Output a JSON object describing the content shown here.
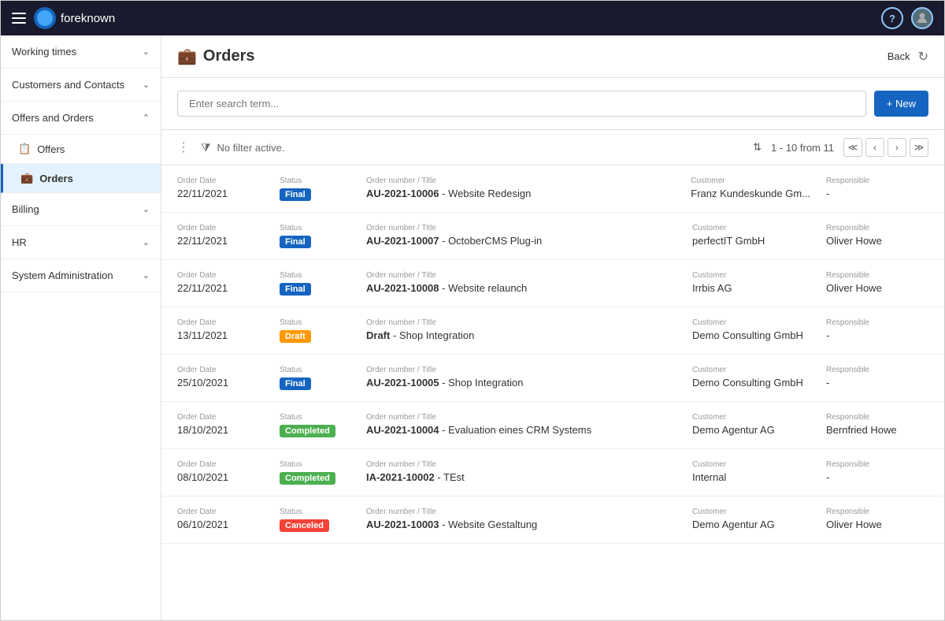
{
  "topbar": {
    "logo_text": "foreknown",
    "help_icon": "?",
    "avatar_icon": "👤"
  },
  "sidebar": {
    "items": [
      {
        "id": "working-times",
        "label": "Working times",
        "expanded": false,
        "has_chevron": true
      },
      {
        "id": "customers-contacts",
        "label": "Customers and Contacts",
        "expanded": false,
        "has_chevron": true
      },
      {
        "id": "offers-orders",
        "label": "Offers and Orders",
        "expanded": true,
        "has_chevron": true,
        "children": [
          {
            "id": "offers",
            "label": "Offers",
            "icon": "📋",
            "current": false
          },
          {
            "id": "orders",
            "label": "Orders",
            "icon": "💼",
            "current": true
          }
        ]
      },
      {
        "id": "billing",
        "label": "Billing",
        "expanded": false,
        "has_chevron": true
      },
      {
        "id": "hr",
        "label": "HR",
        "expanded": false,
        "has_chevron": true
      },
      {
        "id": "system-administration",
        "label": "System Administration",
        "expanded": false,
        "has_chevron": true
      }
    ]
  },
  "page": {
    "title": "Orders",
    "back_label": "Back",
    "new_button_label": "+ New",
    "search_placeholder": "Enter search term...",
    "filter_text": "No filter active.",
    "pagination": {
      "range": "1 - 10 from 11"
    }
  },
  "orders": [
    {
      "date_label": "Order Date",
      "date": "22/11/2021",
      "status_label": "Status",
      "status": "Final",
      "status_type": "final",
      "order_label": "Order number / Title",
      "order_number": "AU-2021-10006",
      "title": "Website Redesign",
      "customer_label": "Customer",
      "customer": "Franz Kundeskunde Gm...",
      "responsible_label": "Responsible",
      "responsible": "-"
    },
    {
      "date_label": "Order Date",
      "date": "22/11/2021",
      "status_label": "Status",
      "status": "Final",
      "status_type": "final",
      "order_label": "Order number / Title",
      "order_number": "AU-2021-10007",
      "title": "OctoberCMS Plug-in",
      "customer_label": "Customer",
      "customer": "perfectIT GmbH",
      "responsible_label": "Responsible",
      "responsible": "Oliver Howe"
    },
    {
      "date_label": "Order Date",
      "date": "22/11/2021",
      "status_label": "Status",
      "status": "Final",
      "status_type": "final",
      "order_label": "Order number / Title",
      "order_number": "AU-2021-10008",
      "title": "Website relaunch",
      "customer_label": "Customer",
      "customer": "Irrbis AG",
      "responsible_label": "Responsible",
      "responsible": "Oliver Howe"
    },
    {
      "date_label": "Order Date",
      "date": "13/11/2021",
      "status_label": "Status",
      "status": "Draft",
      "status_type": "draft",
      "order_label": "Order number / Title",
      "order_number": "Draft",
      "title": "Shop Integration",
      "is_draft_title": true,
      "customer_label": "Customer",
      "customer": "Demo Consulting GmbH",
      "responsible_label": "Responsible",
      "responsible": "-"
    },
    {
      "date_label": "Order Date",
      "date": "25/10/2021",
      "status_label": "Status",
      "status": "Final",
      "status_type": "final",
      "order_label": "Order number / Title",
      "order_number": "AU-2021-10005",
      "title": "Shop Integration",
      "customer_label": "Customer",
      "customer": "Demo Consulting GmbH",
      "responsible_label": "Responsible",
      "responsible": "-"
    },
    {
      "date_label": "Order Date",
      "date": "18/10/2021",
      "status_label": "Status",
      "status": "Completed",
      "status_type": "completed",
      "order_label": "Order number / Title",
      "order_number": "AU-2021-10004",
      "title": "Evaluation eines CRM Systems",
      "customer_label": "Customer",
      "customer": "Demo Agentur AG",
      "responsible_label": "Responsible",
      "responsible": "Bernfried Howe"
    },
    {
      "date_label": "Order Date",
      "date": "08/10/2021",
      "status_label": "Status",
      "status": "Completed",
      "status_type": "completed",
      "order_label": "Order number / Title",
      "order_number": "IA-2021-10002",
      "title": "TEst",
      "customer_label": "Customer",
      "customer": "Internal",
      "responsible_label": "Responsible",
      "responsible": "-"
    },
    {
      "date_label": "Order Date",
      "date": "06/10/2021",
      "status_label": "Status",
      "status": "Canceled",
      "status_type": "canceled",
      "order_label": "Order number / Title",
      "order_number": "AU-2021-10003",
      "title": "Website Gestaltung",
      "customer_label": "Customer",
      "customer": "Demo Agentur AG",
      "responsible_label": "Responsible",
      "responsible": "Oliver Howe"
    }
  ]
}
